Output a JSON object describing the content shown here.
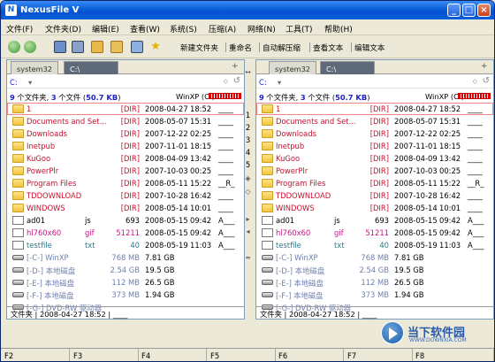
{
  "window": {
    "title": "NexusFile V"
  },
  "menu": [
    "文件(F)",
    "文件夹(D)",
    "编辑(E)",
    "查看(W)",
    "系统(S)",
    "压缩(A)",
    "网络(N)",
    "工具(T)",
    "帮助(H)"
  ],
  "toolbar": {
    "buttons": [
      "新建文件夹",
      "重命名",
      "自动解压缩",
      "查看文本",
      "编辑文本"
    ]
  },
  "colors": {
    "accent": "#1b34c8",
    "dir": "#c8102e",
    "title": "#0a5fd8"
  },
  "panes": [
    {
      "tabs": [
        "system32",
        "C:\\"
      ],
      "drive": "C:",
      "drive_sub": "",
      "count_folders": "9",
      "count_files": "3",
      "size": "50.7 KB",
      "count_text_a": " 个文件夹, ",
      "count_text_b": " 个文件 (",
      "volume": "WinXP (C:)",
      "status": "文件夹 | 2008-04-27 18:52 | ____"
    },
    {
      "tabs": [
        "system32",
        "C:\\"
      ],
      "drive": "C:",
      "drive_sub": "",
      "count_folders": "9",
      "count_files": "3",
      "size": "50.7 KB",
      "count_text_a": " 个文件夹, ",
      "count_text_b": " 个文件 (",
      "volume": "WinXP (C:)",
      "status": "文件夹 | 2008-04-27 18:52 | ____"
    }
  ],
  "files": [
    {
      "name": "1",
      "ext": "",
      "size": "[DIR]",
      "date": "2008-04-27",
      "time": "18:52",
      "attr": "____",
      "kind": "dir"
    },
    {
      "name": "Documents and Set...",
      "ext": "",
      "size": "[DIR]",
      "date": "2008-05-07",
      "time": "15:31",
      "attr": "____",
      "kind": "dir"
    },
    {
      "name": "Downloads",
      "ext": "",
      "size": "[DIR]",
      "date": "2007-12-22",
      "time": "02:25",
      "attr": "____",
      "kind": "dir"
    },
    {
      "name": "Inetpub",
      "ext": "",
      "size": "[DIR]",
      "date": "2007-11-01",
      "time": "18:15",
      "attr": "____",
      "kind": "dir"
    },
    {
      "name": "KuGoo",
      "ext": "",
      "size": "[DIR]",
      "date": "2008-04-09",
      "time": "13:42",
      "attr": "____",
      "kind": "dir"
    },
    {
      "name": "PowerPlr",
      "ext": "",
      "size": "[DIR]",
      "date": "2007-10-03",
      "time": "00:25",
      "attr": "____",
      "kind": "dir"
    },
    {
      "name": "Program Files",
      "ext": "",
      "size": "[DIR]",
      "date": "2008-05-11",
      "time": "15:22",
      "attr": "__R_",
      "kind": "dir"
    },
    {
      "name": "TDDOWNLOAD",
      "ext": "",
      "size": "[DIR]",
      "date": "2007-10-28",
      "time": "16:42",
      "attr": "____",
      "kind": "dir"
    },
    {
      "name": "WINDOWS",
      "ext": "",
      "size": "[DIR]",
      "date": "2008-05-14",
      "time": "10:01",
      "attr": "____",
      "kind": "dir"
    },
    {
      "name": "ad01",
      "ext": "js",
      "size": "693",
      "date": "2008-05-15",
      "time": "09:42",
      "attr": "A___",
      "kind": "js"
    },
    {
      "name": "hl760x60",
      "ext": "gif",
      "size": "51211",
      "date": "2008-05-15",
      "time": "09:42",
      "attr": "A___",
      "kind": "gif"
    },
    {
      "name": "testfile",
      "ext": "txt",
      "size": "40",
      "date": "2008-05-19",
      "time": "11:03",
      "attr": "A___",
      "kind": "txt"
    },
    {
      "name": "[-C-] WinXP",
      "ext": "",
      "size": "768 MB",
      "date": "7.81 GB",
      "time": "",
      "attr": "",
      "kind": "drive"
    },
    {
      "name": "[-D-] 本地磁盘",
      "ext": "",
      "size": "2.54 GB",
      "date": "19.5 GB",
      "time": "",
      "attr": "",
      "kind": "drive"
    },
    {
      "name": "[-E-] 本地磁盘",
      "ext": "",
      "size": "112 MB",
      "date": "26.5 GB",
      "time": "",
      "attr": "",
      "kind": "drive"
    },
    {
      "name": "[-F-] 本地磁盘",
      "ext": "",
      "size": "373 MB",
      "date": "1.94 GB",
      "time": "",
      "attr": "",
      "kind": "drive"
    },
    {
      "name": "[-G-] DVD-RW 驱动器",
      "ext": "",
      "size": "",
      "date": "",
      "time": "",
      "attr": "",
      "kind": "dvd"
    }
  ],
  "gutter_numbers": [
    "1",
    "2",
    "3",
    "4",
    "5"
  ],
  "fkeys": [
    "F2",
    "F3",
    "F4",
    "F5",
    "F6",
    "F7",
    "F8"
  ],
  "watermark": {
    "main": "当下软件园",
    "sub": "WWW.DOWNXIA.COM"
  }
}
